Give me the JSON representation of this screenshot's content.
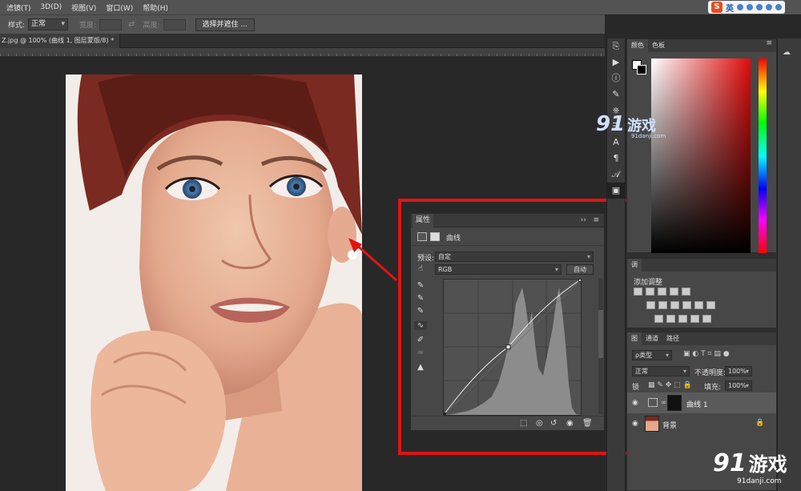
{
  "menubar": {
    "items": [
      "滤镜(T)",
      "3D(D)",
      "视图(V)",
      "窗口(W)",
      "帮助(H)"
    ]
  },
  "ime": {
    "logo": "S",
    "lang": "英"
  },
  "optionsbar": {
    "style_label": "样式:",
    "style_value": "正常",
    "width_label": "宽度:",
    "height_label": "高度:",
    "select_mask_button": "选择并遮住 ..."
  },
  "document_tab": {
    "title": "Z.jpg @ 100% (曲线 1, 图层蒙版/8) *",
    "close": "×"
  },
  "properties": {
    "tab_label": "属性",
    "panel_icons": [
      "››",
      "≡"
    ],
    "adjustment_name": "曲线",
    "preset_label": "预设:",
    "preset_value": "自定",
    "channel_value": "RGB",
    "auto_button": "自动",
    "footer_icons": [
      "clip-to-layer-icon",
      "view-previous-icon",
      "reset-icon",
      "visibility-icon",
      "delete-icon"
    ]
  },
  "curve": {
    "points": [
      [
        0,
        0
      ],
      [
        120,
        128
      ],
      [
        255,
        255
      ]
    ],
    "histogram_peaks": "dark-mid and highlight peaks"
  },
  "color_panel": {
    "tabs": [
      "颜色",
      "色板"
    ],
    "hue_color": "#e00b0b"
  },
  "adjustments_panel": {
    "title": "调",
    "add_label": "添加调整"
  },
  "layers_panel": {
    "tabs": [
      "图",
      "通道",
      "路径"
    ],
    "filter_label": "ρ类型",
    "blend_mode": "正常",
    "opacity_label": "不透明度:",
    "opacity_value": "100%",
    "lock_label": "锁",
    "fill_label": "填充:",
    "fill_value": "100%",
    "layers": [
      {
        "name": "曲线 1",
        "type": "adjustment"
      },
      {
        "name": "背景",
        "type": "image"
      }
    ]
  },
  "watermark": {
    "top_num": "91",
    "top_cn": "游戏",
    "top_url": "91danji.com",
    "bottom_num": "91",
    "bottom_cn": "游戏",
    "bottom_url": "91danji.com"
  }
}
